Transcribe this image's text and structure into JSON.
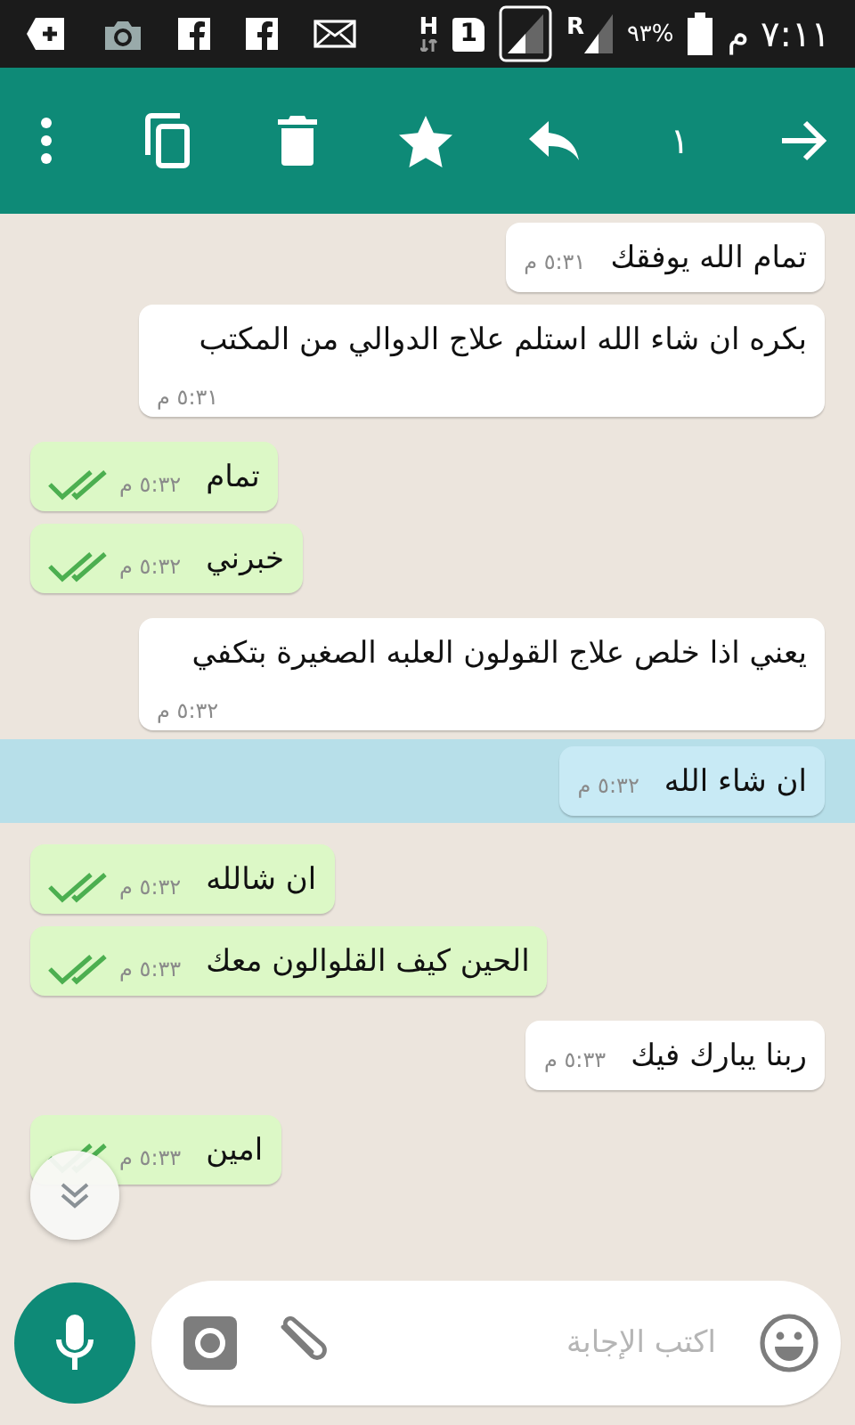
{
  "status_bar": {
    "network_type": "H",
    "sim_slot": "1",
    "roaming": "R",
    "battery": "٩٣%",
    "time": "٧:١١ م"
  },
  "toolbar": {
    "selected_count": "١"
  },
  "messages": [
    {
      "kind": "incoming",
      "text": "تمام الله يوفقك",
      "time": "٥:٣١ م",
      "selected": false
    },
    {
      "kind": "incoming",
      "text": "بكره ان شاء الله استلم علاج الدوالي من المكتب",
      "time": "٥:٣١ م",
      "selected": false
    },
    {
      "kind": "outgoing",
      "text": "تمام",
      "time": "٥:٣٢ م",
      "selected": false
    },
    {
      "kind": "outgoing",
      "text": "خبرني",
      "time": "٥:٣٢ م",
      "selected": false
    },
    {
      "kind": "incoming",
      "text": "يعني اذا خلص علاج القولون العلبه الصغيرة بتكفي",
      "time": "٥:٣٢ م",
      "selected": false
    },
    {
      "kind": "incoming",
      "text": "ان شاء الله",
      "time": "٥:٣٢ م",
      "selected": true
    },
    {
      "kind": "outgoing",
      "text": "ان شالله",
      "time": "٥:٣٢ م",
      "selected": false
    },
    {
      "kind": "outgoing",
      "text": "الحين كيف القلوالون معك",
      "time": "٥:٣٣ م",
      "selected": false
    },
    {
      "kind": "incoming",
      "text": "ربنا يبارك فيك",
      "time": "٥:٣٣ م",
      "selected": false
    },
    {
      "kind": "outgoing",
      "text": "امين",
      "time": "٥:٣٣ م",
      "selected": false
    }
  ],
  "composer": {
    "placeholder": "اكتب الإجابة"
  }
}
